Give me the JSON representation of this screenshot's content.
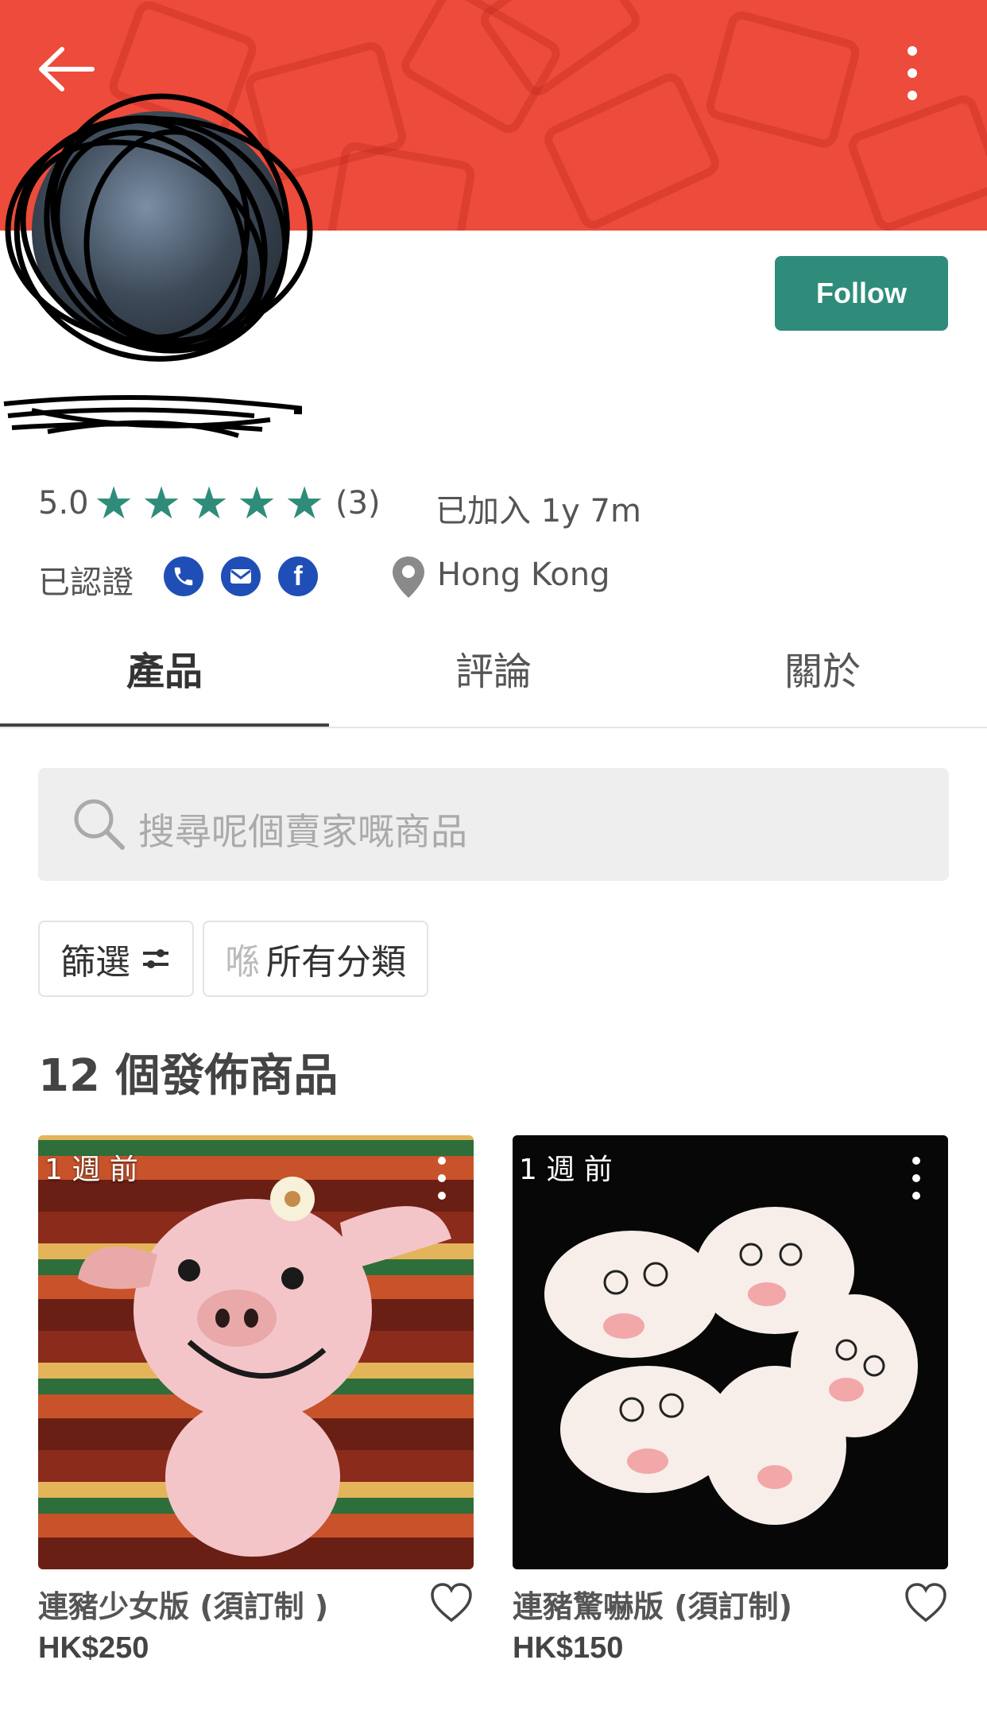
{
  "header": {
    "follow_label": "Follow"
  },
  "profile": {
    "rating": "5.0",
    "star_count": 5,
    "review_count": "(3)",
    "joined": "已加入 1y 7m",
    "verified_label": "已認證",
    "verify_icons": [
      "phone-icon",
      "email-icon",
      "facebook-icon"
    ],
    "location": "Hong Kong"
  },
  "tabs": [
    {
      "label": "產品",
      "active": true
    },
    {
      "label": "評論",
      "active": false
    },
    {
      "label": "關於",
      "active": false
    }
  ],
  "search": {
    "placeholder": "搜尋呢個賣家嘅商品"
  },
  "filters": {
    "filter_label": "篩選",
    "category_prefix": "喺",
    "category_value": "所有分類"
  },
  "listings": {
    "count_label": "12 個發佈商品",
    "items": [
      {
        "time": "1 週 前",
        "title": "連豬少女版 (須訂制 )",
        "price": "HK$250"
      },
      {
        "time": "1 週 前",
        "title": "連豬驚嚇版 (須訂制)",
        "price": "HK$150"
      }
    ]
  },
  "colors": {
    "banner": "#ed4b3b",
    "accent": "#2f8c7a",
    "verify": "#1f4fb6"
  }
}
